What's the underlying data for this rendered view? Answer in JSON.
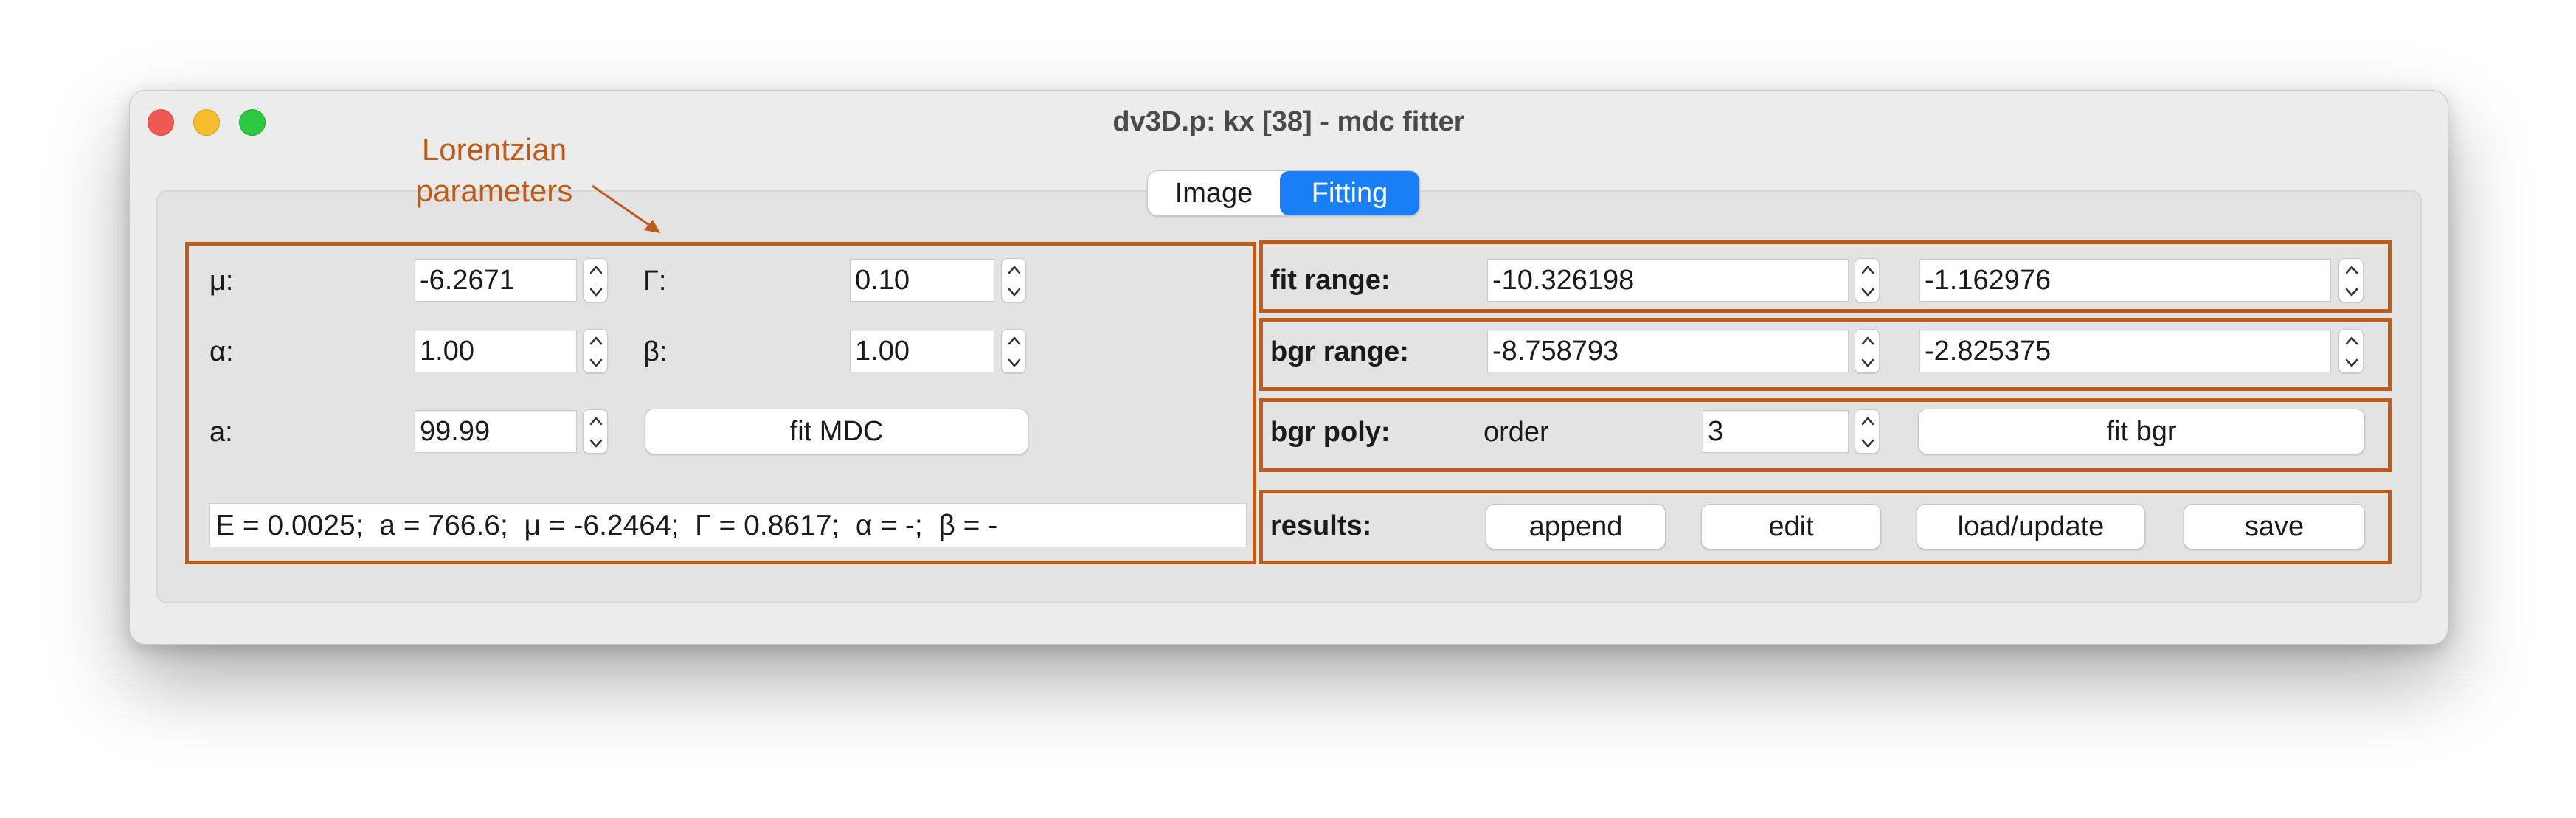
{
  "window": {
    "title": "dv3D.p: kx [38] - mdc fitter"
  },
  "tabs": {
    "items": [
      "Image",
      "Fitting"
    ],
    "selected": "Fitting"
  },
  "annotation": {
    "line1": "Lorentzian",
    "line2": "parameters",
    "color": "#c05a18"
  },
  "lorentzian": {
    "mu": {
      "label": "μ:",
      "value": "-6.2671"
    },
    "gamma": {
      "label": "Γ:",
      "value": "0.10"
    },
    "alpha": {
      "label": "α:",
      "value": "1.00"
    },
    "beta": {
      "label": "β:",
      "value": "1.00"
    },
    "a": {
      "label": "a:",
      "value": "99.99"
    },
    "fit_mdc_label": "fit MDC",
    "result_text": "E = 0.0025;  a = 766.6;  μ = -6.2464;  Γ = 0.8617;  α = -;  β = -"
  },
  "fit_range": {
    "label": "fit range:",
    "min": "-10.326198",
    "max": "-1.162976"
  },
  "bgr_range": {
    "label": "bgr range:",
    "min": "-8.758793",
    "max": "-2.825375"
  },
  "bgr_poly": {
    "label": "bgr poly:",
    "order_label": "order",
    "order_value": "3",
    "fit_bgr_label": "fit bgr"
  },
  "results": {
    "label": "results:",
    "append_label": "append",
    "edit_label": "edit",
    "load_update_label": "load/update",
    "save_label": "save"
  },
  "colors": {
    "accent": "#1a7ff7",
    "close": "#ee5a52",
    "minimize": "#f5bd2c",
    "maximize": "#2cc840"
  }
}
